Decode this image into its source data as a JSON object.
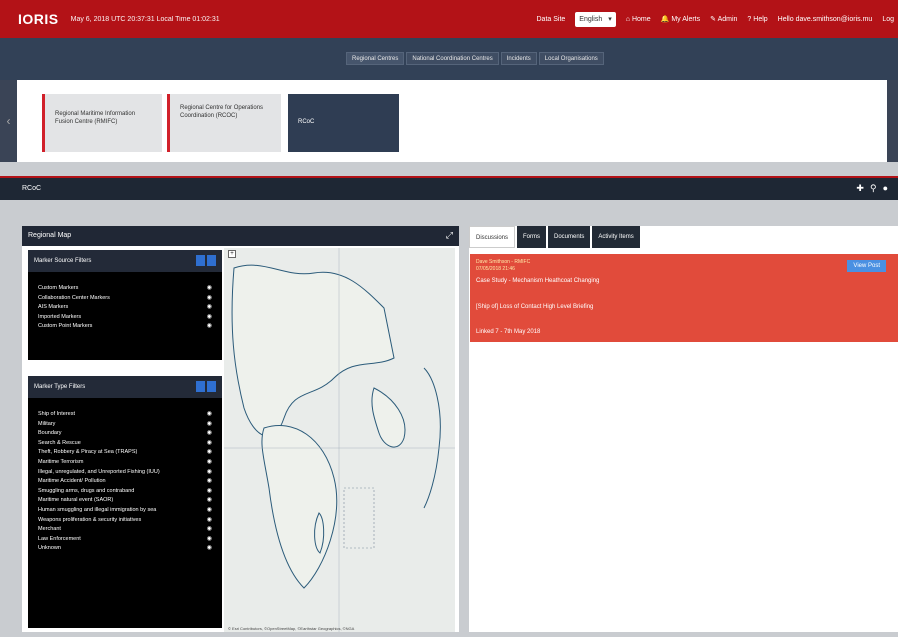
{
  "app": {
    "logo": "IORIS",
    "datetime": "May 6, 2018   UTC 20:37:31   Local Time 01:02:31"
  },
  "topnav": {
    "data_site": "Data Site",
    "language": "English",
    "home": "Home",
    "my_alerts": "My Alerts",
    "admin": "Admin",
    "help": "Help",
    "user": "Hello dave.smithson@ioris.mu",
    "logout": "Log"
  },
  "tabs": [
    "Regional Centres",
    "National Coordination Centres",
    "Incidents",
    "Local Organisations"
  ],
  "cards": [
    {
      "text": "Regional Maritime Information Fusion Centre (RMIFC)"
    },
    {
      "text": "Regional Centre for Operations Coordination (RCOC)"
    },
    {
      "text": "RCoC"
    }
  ],
  "section": {
    "title": "RCoC"
  },
  "regional_map": {
    "title": "Regional Map"
  },
  "marker_source": {
    "title": "Marker Source Filters",
    "items": [
      "Custom Markers",
      "Collaboration Center Markers",
      "AIS Markers",
      "Imported Markers",
      "Custom Point Markers"
    ]
  },
  "marker_type": {
    "title": "Marker Type Filters",
    "items": [
      "Ship of Interest",
      "Military",
      "Boundary",
      "Search & Rescue",
      "Theft, Robbery & Piracy at Sea (TRAPS)",
      "Maritime Terrorism",
      "Illegal, unregulated, and Unreported Fishing (IUU)",
      "Maritime Accident/ Pollution",
      "Smuggling arms, drugs and contraband",
      "Maritime natural event (SAOR)",
      "Human smuggling and illegal immigration by sea",
      "Weapons proliferation & security initiatives",
      "Merchant",
      "Law Enforcement",
      "Unknown"
    ]
  },
  "map": {
    "credit": "© Esri Contributors, ©OpenStreetMap, ©Earthstar Geographics, ©NGA"
  },
  "right_tabs": [
    "Discussions",
    "Forms",
    "Documents",
    "Activity Items"
  ],
  "alert": {
    "line1": "Dave Smithson - RMIFC",
    "line2": "07/05/2018 21:46",
    "line3": "Case Study - Mechanism Heathcoat Changing",
    "line4": "[Ship of] Loss of Contact High Level Briefing",
    "line5": "Linked 7 - 7th May 2018",
    "button": "View Post"
  },
  "colors": {
    "brand": "#b31217",
    "nav": "#324157",
    "alert": "#e14b3b",
    "button": "#4a90e2"
  }
}
